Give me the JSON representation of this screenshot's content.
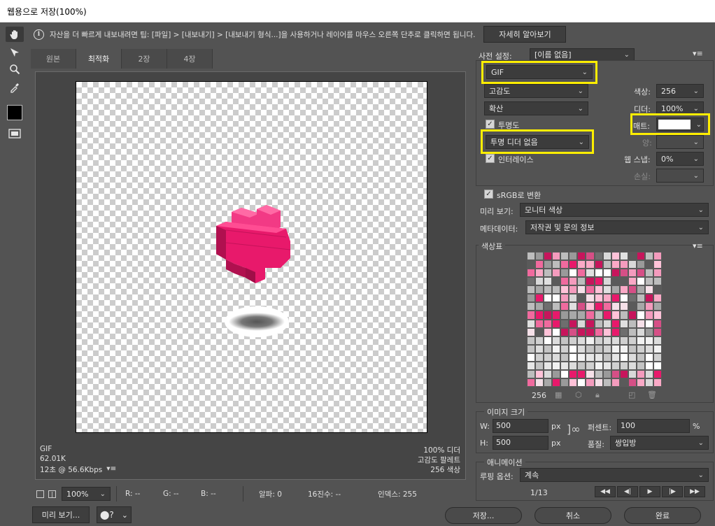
{
  "window": {
    "title": "웹용으로 저장(100%)"
  },
  "tip": {
    "text": "자산을 더 빠르게 내보내려면 팁: [파일] > [내보내기] > [내보내기 형식...]을 사용하거나 레이어를 마우스 오른쪽 단추로 클릭하면 됩니다.",
    "learn_more": "자세히 알아보기"
  },
  "tabs": [
    "원본",
    "최적화",
    "2장",
    "4장"
  ],
  "image_info": {
    "format": "GIF",
    "size": "62.01K",
    "time": "12초 @ 56.6Kbps",
    "dither": "100% 디더",
    "palette": "고감도 팔레트",
    "colors": "256 색상"
  },
  "bottom_bar": {
    "zoom": "100%",
    "r": "R: --",
    "g": "G: --",
    "b": "B: --",
    "alpha": "알파: 0",
    "hex": "16진수: --",
    "index": "인덱스: 255"
  },
  "buttons": {
    "preview": "미리 보기...",
    "save": "저장...",
    "cancel": "취소",
    "done": "완료"
  },
  "preset": {
    "label": "사전 설정:",
    "value": "[이름 없음]"
  },
  "settings": {
    "format": "GIF",
    "reduction": "고감도",
    "dither_algo": "확산",
    "transparency_label": "투명도",
    "transparency_dither": "투명 디더 없음",
    "interlaced_label": "인터레이스",
    "colors_label": "색상:",
    "colors_value": "256",
    "dither_label": "디더:",
    "dither_value": "100%",
    "matte_label": "매트:",
    "amount_label": "양:",
    "websnap_label": "웹 스냅:",
    "websnap_value": "0%",
    "lossy_label": "손실:",
    "srgb_label": "sRGB로 변환",
    "preview_label": "미리 보기:",
    "preview_value": "모니터 색상",
    "metadata_label": "메타데이터:",
    "metadata_value": "저작권 및 문의 정보"
  },
  "color_table": {
    "title": "색상표",
    "count": "256"
  },
  "image_size": {
    "title": "이미지 크기",
    "w_label": "W:",
    "w_value": "500",
    "h_label": "H:",
    "h_value": "500",
    "unit": "px",
    "percent_label": "퍼센트:",
    "percent_value": "100",
    "percent_unit": "%",
    "quality_label": "품질:",
    "quality_value": "쌍입방"
  },
  "animation": {
    "title": "애니메이션",
    "loop_label": "루핑 옵션:",
    "loop_value": "계속",
    "frame": "1/13"
  },
  "colors": {
    "highlight": "#ffee00",
    "heart": "#e8196b",
    "panel": "#535353"
  }
}
